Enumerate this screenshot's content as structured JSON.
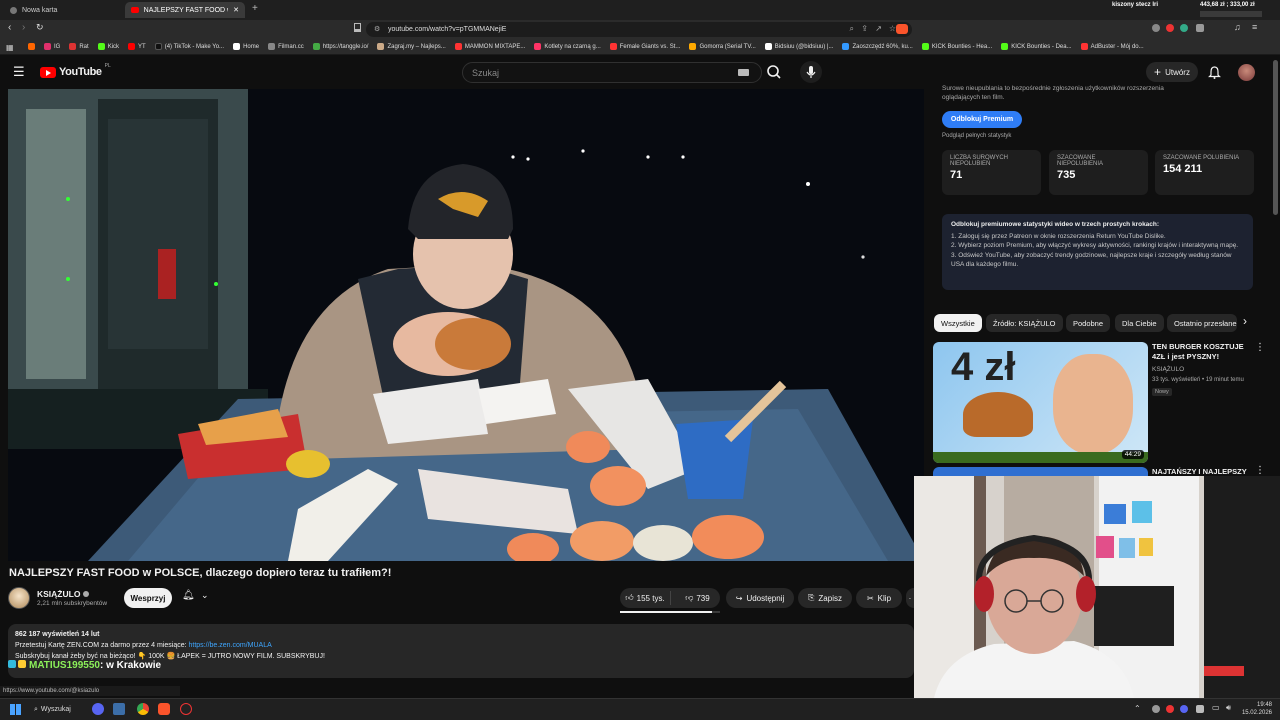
{
  "browser": {
    "tabs": [
      {
        "label": "Nowa karta",
        "active": false
      },
      {
        "label": "NAJLEPSZY FAST FOOD w PO",
        "active": true
      }
    ],
    "new_tab_symbol": "+",
    "top_right_title": "kiszony stecz lri",
    "top_right_values": "443,68 zł  ;  333,00 zł",
    "url": "youtube.com/watch?v=pTGMMANejiE",
    "bookmarks": [
      {
        "label": "IG",
        "color": "#e1306c"
      },
      {
        "label": "Rat",
        "color": "#d33"
      },
      {
        "label": "Kick",
        "color": "#53fc18"
      },
      {
        "label": "YT",
        "color": "#ff0000"
      },
      {
        "label": "(4) TikTok - Make Yo...",
        "color": "#111"
      },
      {
        "label": "Home",
        "color": "#fff"
      },
      {
        "label": "Filman.cc",
        "color": "#888"
      },
      {
        "label": "https://tanggle.io/",
        "color": "#4a4"
      },
      {
        "label": "Zagraj.my – Najleps...",
        "color": "#ca8"
      },
      {
        "label": "MAMMON MIXTAPE...",
        "color": "#f33"
      },
      {
        "label": "Kotlety na czarną g...",
        "color": "#f36"
      },
      {
        "label": "Female Giants vs. St...",
        "color": "#f33"
      },
      {
        "label": "Gomorra (Serial TV...",
        "color": "#fa0"
      },
      {
        "label": "Bidsiuu (@bidsiuu) |...",
        "color": "#fff"
      },
      {
        "label": "Zaoszczędź 60%, ku...",
        "color": "#39f"
      },
      {
        "label": "KICK Bounties - Hea...",
        "color": "#53fc18"
      },
      {
        "label": "KICK Bounties - Dea...",
        "color": "#53fc18"
      },
      {
        "label": "AdBuster - Mój do...",
        "color": "#f33"
      }
    ]
  },
  "youtube": {
    "logo": "YouTube",
    "logo_region": "PL",
    "search_placeholder": "Szukaj",
    "create_label": "Utwórz"
  },
  "video": {
    "title": "NAJLEPSZY FAST FOOD w POLSCE, dlaczego dopiero teraz tu trafiłem?!",
    "channel": "KSIĄŻULO",
    "subscribers": "2,21 mln subskrybentów",
    "support_label": "Wesprzyj",
    "likes": "155 tys.",
    "dislikes": "739",
    "share_label": "Udostępnij",
    "save_label": "Zapisz",
    "clip_label": "Klip",
    "stats_line": "862 187 wyświetleń  14 lut",
    "desc_line1_prefix": "Przetestuj Kartę ZEN.COM za darmo przez 4 miesiące: ",
    "desc_link": "https://be.zen.com/MUALA",
    "desc_line2": "Subskrybuj kanał żeby być na bieżąco! 👇 100K 🍔 ŁAPEK = JUTRO NOWY FILM. SUBSKRYBUJ!",
    "status_url": "https://www.youtube.com/@ksiazulo",
    "chat_overlay_user": "MATIUS199550",
    "chat_overlay_text": "w Krakowie"
  },
  "sidebar": {
    "extension_text_top": "Surowe nieupublania to bezpośrednie zgłoszenia użytkowników rozszerzenia oglądających ten film.",
    "unlock_button": "Odblokuj Premium",
    "full_stats_link": "Podgląd pełnych statystyk",
    "stats": [
      {
        "label": "LICZBA SUROWYCH NIEPOLUBIEŃ",
        "value": "71"
      },
      {
        "label": "SZACOWANE NIEPOLUBIENIA",
        "value": "735"
      },
      {
        "label": "SZACOWANE POLUBIENIA",
        "value": "154 211"
      }
    ],
    "info_title": "Odblokuj premiumowe statystyki wideo w trzech prostych krokach:",
    "info_steps": [
      "1. Zaloguj się przez Patreon w oknie rozszerzenia Return YouTube Dislike.",
      "2. Wybierz poziom Premium, aby włączyć wykresy aktywności, rankingi krajów i interaktywną mapę.",
      "3. Odśwież YouTube, aby zobaczyć trendy godzinowe, najlepsze kraje i szczegóły według stanów USA dla każdego filmu."
    ],
    "chips": [
      "Wszystkie",
      "Źródło: KSIĄŻULO",
      "Podobne",
      "Dla Ciebie",
      "Ostatnio przesłane"
    ],
    "recommended": [
      {
        "title": "TEN BURGER KOSZTUJE 4ZŁ i jest PYSZNY!",
        "channel": "KSIĄŻULO",
        "meta": "33 tys. wyświetleń • 19 minut temu",
        "badge": "Nowy",
        "duration": "44:29",
        "thumb_text": "4 zł"
      },
      {
        "title": "NAJTAŃSZY I NAJLEPSZY",
        "channel": "",
        "meta": "",
        "badge": "",
        "duration": "",
        "thumb_text": ""
      }
    ]
  },
  "taskbar": {
    "search_label": "Wyszukaj",
    "time": "19:48",
    "date": "15.02.2026"
  },
  "colors": {
    "yt_red": "#ff0000",
    "accent_blue": "#3ea6ff",
    "premium_blue": "#2f7df6"
  }
}
